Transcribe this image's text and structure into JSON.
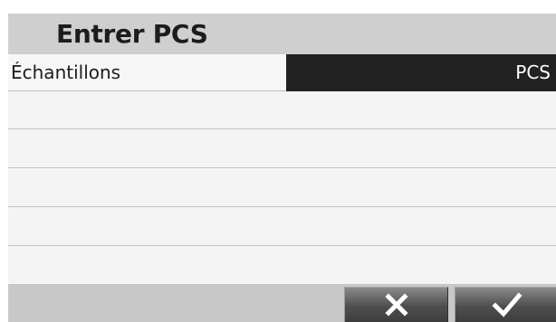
{
  "title": "Entrer PCS",
  "table": {
    "header_left": "Échantillons",
    "header_right": "PCS",
    "rows": [
      "",
      "",
      "",
      "",
      ""
    ]
  },
  "footer": {
    "cancel_icon": "close-icon",
    "confirm_icon": "checkmark-icon"
  },
  "colors": {
    "title_bar": "#cfcfcf",
    "selected_cell": "#222222",
    "background": "#f4f4f4",
    "footer": "#c8c8c8"
  }
}
